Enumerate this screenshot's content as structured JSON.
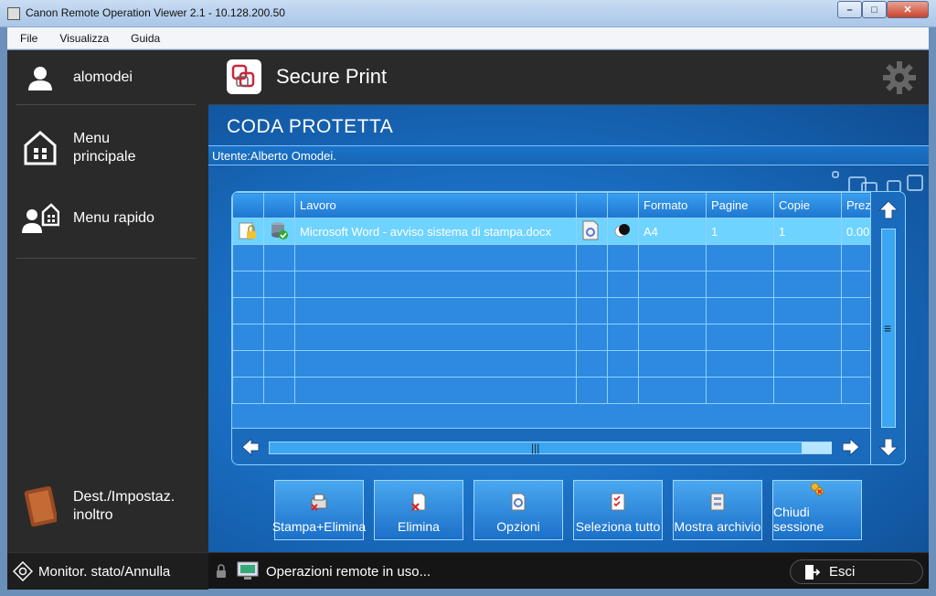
{
  "window": {
    "title": "Canon Remote Operation Viewer 2.1 - 10.128.200.50",
    "controls": {
      "minimize": "–",
      "maximize": "□",
      "close": "✕"
    }
  },
  "menubar": {
    "items": [
      "File",
      "Visualizza",
      "Guida"
    ]
  },
  "sidebar": {
    "user": "alomodei",
    "main_menu_line1": "Menu",
    "main_menu_line2": "principale",
    "quick_menu": "Menu rapido",
    "dest_line1": "Dest./Impostaz.",
    "dest_line2": "inoltro"
  },
  "header": {
    "app_title": "Secure Print"
  },
  "queue": {
    "title": "CODA PROTETTA",
    "user_label": "Utente:Alberto  Omodei."
  },
  "table": {
    "columns": [
      "",
      "",
      "Lavoro",
      "",
      "",
      "Formato",
      "Pagine",
      "Copie",
      "Prez"
    ],
    "rows": [
      {
        "job": "Microsoft Word - avviso sistema di stampa.docx",
        "format": "A4",
        "pages": "1",
        "copies": "1",
        "price": "0.00"
      }
    ],
    "empty_rows": 6
  },
  "buttons": {
    "print_delete": "Stampa+Elimina",
    "delete": "Elimina",
    "options": "Opzioni",
    "select_all": "Seleziona tutto",
    "show_archive": "Mostra archivio",
    "close_session": "Chiudi sessione"
  },
  "status": {
    "monitor": "Monitor. stato/Annulla",
    "message": "Operazioni remote in uso...",
    "exit": "Esci"
  },
  "colors": {
    "accent": "#1a6fc4",
    "selected_row": "#6fd3ff",
    "panel_dark": "#2a2a2a"
  }
}
